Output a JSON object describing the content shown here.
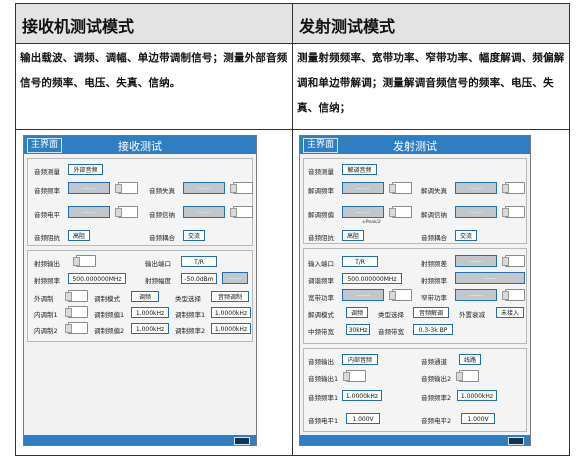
{
  "table": {
    "headers": [
      "接收机测试模式",
      "发射测试模式"
    ],
    "descriptions": [
      "输出载波、调频、调幅、单边带调制信号；测量外部音频信号的频率、电压、失真、信纳。",
      "测量射频频率、宽带功率、窄带功率、幅度解调、频偏解调和单边带解调；测量解调音频信号的频率、电压、失真、信纳；"
    ]
  },
  "receive": {
    "home": "主界面",
    "title": "接收测试",
    "audio_measure": "音频测量",
    "audio_source": "外部音频",
    "audio_freq": "音频频率",
    "audio_dist": "音频失真",
    "audio_level": "音频电平",
    "audio_sinad": "音频信纳",
    "audio_imp": "音频阻抗",
    "imp_val": "高阻",
    "audio_coupling": "音频耦合",
    "coupling_val": "交流",
    "rf_out": "射频输出",
    "out_port": "输出端口",
    "port_val": "T/R",
    "rf_freq": "射频频率",
    "rf_freq_val": "500.000000MHz",
    "rf_amp": "射频幅度",
    "rf_amp_val": "-50.0dBm",
    "ext_mod": "外调制",
    "mod_mode": "调制模式",
    "mod_mode_val": "调频",
    "type_sel": "类型选择",
    "type_val": "音频调制",
    "int_mod1": "内调制1",
    "mod_freq1": "调制频偏1",
    "mod_freq1_val": "1.000kHz",
    "mod_rate1": "调制频率1",
    "mod_rate1_val": "1.0000kHz",
    "int_mod2": "内调制2",
    "mod_freq2": "调制频偏2",
    "mod_freq2_val": "1.000kHz",
    "mod_rate2": "调制频率2",
    "mod_rate2_val": "1.0000kHz",
    "placeholder": "------"
  },
  "transmit": {
    "home": "主界面",
    "title": "发射测试",
    "audio_measure": "音频测量",
    "audio_source": "解调音频",
    "demod_freq": "解调频率",
    "demod_dist": "解调失真",
    "demod_dev": "解调频偏",
    "demod_sinad": "解调信纳",
    "peak_note": "±Peak/2",
    "audio_imp": "音频阻抗",
    "imp_val": "高阻",
    "audio_coupling": "音频耦合",
    "coupling_val": "交流",
    "in_port": "输入端口",
    "port_val": "T/R",
    "rf_error": "射频频差",
    "tune_freq": "调谐频率",
    "tune_val": "500.000000MHz",
    "rf_freq": "射频频率",
    "wide_power": "宽带功率",
    "narrow_power": "窄带功率",
    "demod_mode": "解调模式",
    "demod_mode_val": "调频",
    "type_sel": "类型选择",
    "type_val": "音频解调",
    "ext_atten": "外置衰减",
    "atten_val": "未接入",
    "if_bw": "中频带宽",
    "if_bw_val": "30kHz",
    "audio_bw": "音频带宽",
    "audio_bw_val": "0.3-3k BP",
    "audio_out": "音频输出",
    "audio_out_val": "内部音频",
    "audio_chan": "音频通道",
    "audio_chan_val": "线路",
    "audio_out1": "音频输出1",
    "audio_out2": "音频输出2",
    "audio_freq1": "音频频率1",
    "audio_freq1_val": "1.0000kHz",
    "audio_freq2": "音频频率2",
    "audio_freq2_val": "1.0000kHz",
    "audio_level1": "音频电平1",
    "audio_level1_val": "1.000V",
    "audio_level2": "音频电平2",
    "audio_level2_val": "1.000V",
    "placeholder": "------"
  }
}
